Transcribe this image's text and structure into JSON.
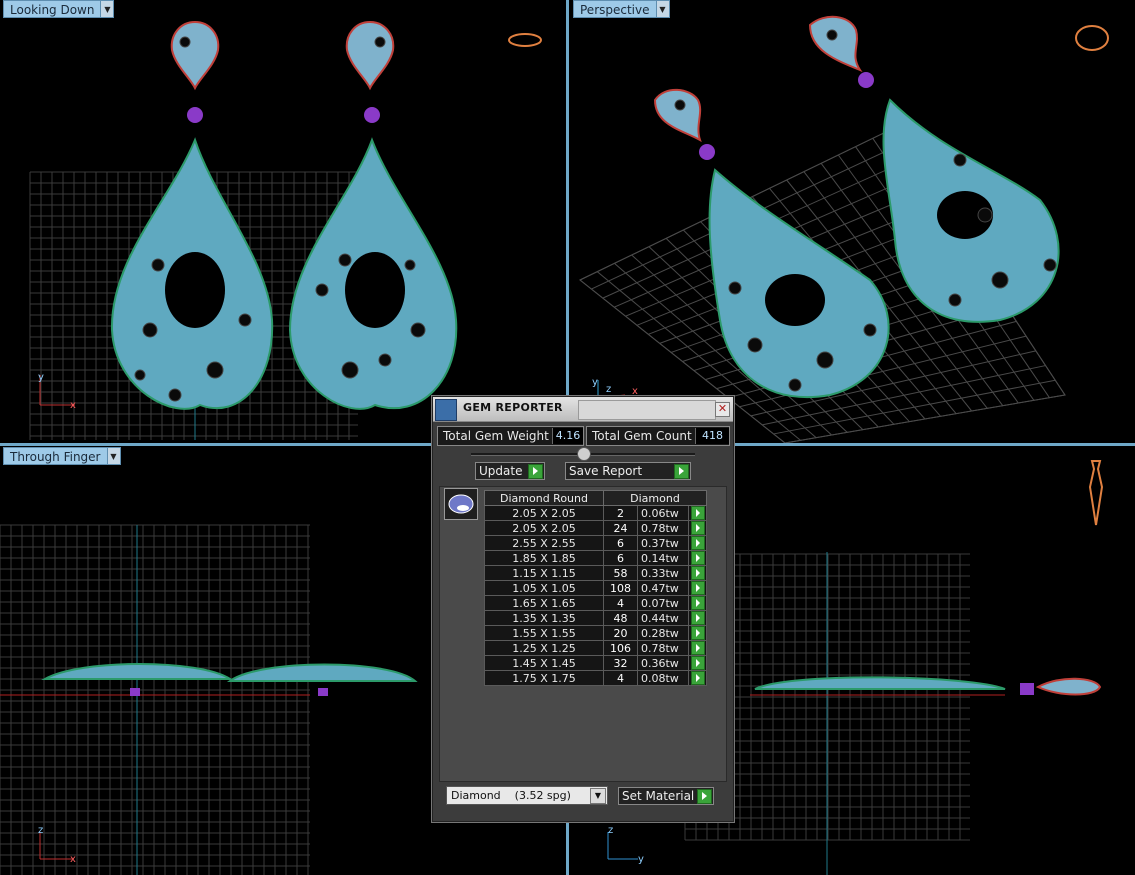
{
  "viewports": {
    "top_left": {
      "label": "Looking Down"
    },
    "top_right": {
      "label": "Perspective"
    },
    "bottom_left": {
      "label": "Through Finger"
    }
  },
  "axes": {
    "top_left": {
      "a": "y",
      "b": "x"
    },
    "top_right": {
      "a": "y",
      "b": "z",
      "c": "x"
    },
    "bottom_left": {
      "a": "z",
      "b": "x"
    },
    "bottom_right": {
      "a": "z",
      "b": "y"
    }
  },
  "gem_reporter": {
    "title": "GEM REPORTER",
    "total_weight_label": "Total Gem Weight",
    "total_weight_value": "4.16",
    "total_count_label": "Total Gem Count",
    "total_count_value": "418",
    "update_label": "Update",
    "save_report_label": "Save Report",
    "table": {
      "header_cut": "Diamond Round",
      "header_material": "Diamond",
      "rows": [
        {
          "size": "2.05 X 2.05",
          "count": "2",
          "weight": "0.06tw"
        },
        {
          "size": "2.05 X 2.05",
          "count": "24",
          "weight": "0.78tw"
        },
        {
          "size": "2.55 X 2.55",
          "count": "6",
          "weight": "0.37tw"
        },
        {
          "size": "1.85 X 1.85",
          "count": "6",
          "weight": "0.14tw"
        },
        {
          "size": "1.15 X 1.15",
          "count": "58",
          "weight": "0.33tw"
        },
        {
          "size": "1.05 X 1.05",
          "count": "108",
          "weight": "0.47tw"
        },
        {
          "size": "1.65 X 1.65",
          "count": "4",
          "weight": "0.07tw"
        },
        {
          "size": "1.35 X 1.35",
          "count": "48",
          "weight": "0.44tw"
        },
        {
          "size": "1.55 X 1.55",
          "count": "20",
          "weight": "0.28tw"
        },
        {
          "size": "1.25 X 1.25",
          "count": "106",
          "weight": "0.78tw"
        },
        {
          "size": "1.45 X 1.45",
          "count": "32",
          "weight": "0.36tw"
        },
        {
          "size": "1.75 X 1.75",
          "count": "4",
          "weight": "0.08tw"
        }
      ]
    },
    "material_value": "Diamond    (3.52 spg)",
    "set_material_label": "Set Material"
  }
}
